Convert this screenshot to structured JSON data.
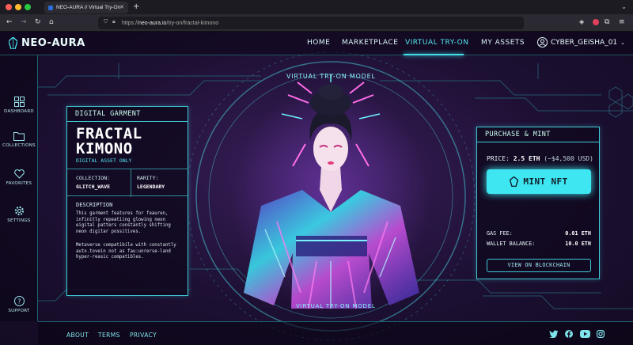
{
  "browser": {
    "tab_title": "NEO-AURA // Virtual Try-On",
    "url_scheme": "https://",
    "url_host": "neo-aura.io",
    "url_path": "/try-on/fractal-kimono",
    "icons": [
      "back-icon",
      "forward-icon",
      "reload-icon",
      "home-icon",
      "shield-icon",
      "lock-icon",
      "pocket-icon",
      "extension-icon",
      "menu-icon"
    ]
  },
  "site": {
    "logo": "NEO-AURA",
    "nav": [
      "HOME",
      "MARKETPLACE",
      "VIRTUAL TRY-ON",
      "MY ASSETS"
    ],
    "active_nav": 2,
    "username": "CYBER_GEISHA_01",
    "accent": "#3ee6f2",
    "background": "#1d1033"
  },
  "sidebar": {
    "items": [
      {
        "label": "DASHBOARD",
        "icon": "grid-icon"
      },
      {
        "label": "COLLECTIONS",
        "icon": "folder-icon"
      },
      {
        "label": "FAVORITES",
        "icon": "heart-icon"
      },
      {
        "label": "SETTINGS",
        "icon": "gear-icon"
      }
    ],
    "support": {
      "label": "SUPPORT",
      "icon": "question-icon"
    }
  },
  "model": {
    "title_top": "VIRTUAL TRY-ON MODEL",
    "title_bottom": "VIRTUAL TRY-ON MODEL"
  },
  "garment": {
    "heading": "DIGITAL GARMENT",
    "name_line1": "FRACTAL",
    "name_line2": "KIMONO",
    "subtitle": "DIGITAL ASSET ONLY",
    "collection_label": "COLLECTION:",
    "collection_value": "GLITCH_WAVE",
    "rarity_label": "RARITY:",
    "rarity_value": "LEGENDARY",
    "description_heading": "DESCRIPTION",
    "description_p1": [
      "This garment features for feauren,",
      "infinitly repeatiing glowing neon",
      "eigital patters constantly shifting",
      "neon digitar possitives."
    ],
    "description_p2": [
      "Metaverse compatibile with constantly",
      "auto.tovein not as fau:unrerse-land",
      "hyper-reasic compatibles."
    ]
  },
  "purchase": {
    "heading": "PURCHASE & MINT",
    "price_label": "PRICE:",
    "price_value": "2.5 ETH",
    "price_usd": "(~$4,500 USD)",
    "mint_button": "MINT NFT",
    "gas_label": "GAS FEE:",
    "gas_value": "0.01 ETH",
    "balance_label": "WALLET BALANCE:",
    "balance_value": "10.0 ETH",
    "chain_button": "VIEW ON BLOCKCHAIN"
  },
  "footer": {
    "links": [
      "ABOUT",
      "TERMS",
      "PRIVACY"
    ],
    "social_icons": [
      "twitter-icon",
      "facebook-icon",
      "youtube-icon",
      "instagram-icon"
    ]
  }
}
